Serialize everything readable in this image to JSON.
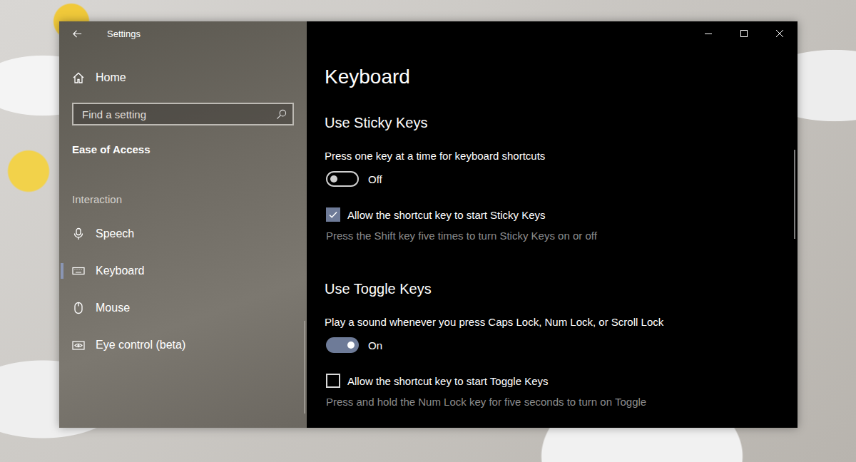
{
  "window": {
    "title": "Settings"
  },
  "sidebar": {
    "home": "Home",
    "search": {
      "placeholder": "Find a setting"
    },
    "category": "Ease of Access",
    "group": "Interaction",
    "items": [
      {
        "label": "Speech",
        "selected": false
      },
      {
        "label": "Keyboard",
        "selected": true
      },
      {
        "label": "Mouse",
        "selected": false
      },
      {
        "label": "Eye control (beta)",
        "selected": false
      }
    ]
  },
  "page": {
    "title": "Keyboard",
    "sections": [
      {
        "heading": "Use Sticky Keys",
        "toggle": {
          "label": "Press one key at a time for keyboard shortcuts",
          "on": false,
          "state_text": "Off"
        },
        "checkbox": {
          "label": "Allow the shortcut key to start Sticky Keys",
          "checked": true,
          "hint": "Press the Shift key five times to turn Sticky Keys on or off"
        }
      },
      {
        "heading": "Use Toggle Keys",
        "toggle": {
          "label": "Play a sound whenever you press Caps Lock, Num Lock, or Scroll Lock",
          "on": true,
          "state_text": "On"
        },
        "checkbox": {
          "label": "Allow the shortcut key to start Toggle Keys",
          "checked": false,
          "hint": "Press and hold the Num Lock key for five seconds to turn on Toggle"
        }
      }
    ]
  }
}
